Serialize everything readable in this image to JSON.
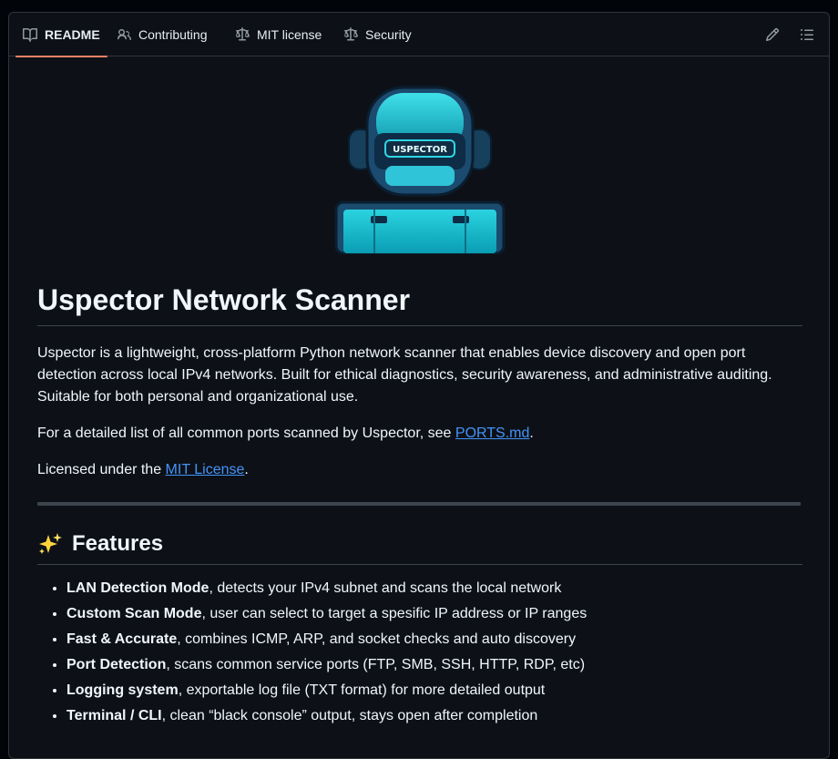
{
  "tabs": [
    {
      "label": "README",
      "icon": "book-icon",
      "active": true
    },
    {
      "label": "Contributing",
      "icon": "people-icon",
      "active": false
    },
    {
      "label": "MIT license",
      "icon": "scale-icon",
      "active": false
    },
    {
      "label": "Security",
      "icon": "scale-icon",
      "active": false
    }
  ],
  "toolbar": {
    "edit_icon": "pencil-icon",
    "outline_icon": "list-icon"
  },
  "logo": {
    "text": "USPECTOR",
    "accent_color": "#1ec8d6"
  },
  "readme": {
    "title": "Uspector Network Scanner",
    "intro": "Uspector is a lightweight, cross-platform Python network scanner that enables device discovery and open port detection across local IPv4 networks. Built for ethical diagnostics, security awareness, and administrative auditing. Suitable for both personal and organizational use.",
    "ports_prefix": "For a detailed list of all common ports scanned by Uspector, see ",
    "ports_link": "PORTS.md",
    "ports_suffix": ".",
    "license_prefix": "Licensed under the ",
    "license_link": "MIT License",
    "license_suffix": ".",
    "features_title": "Features",
    "features_emoji": "sparkles-icon",
    "features": [
      {
        "bold": "LAN Detection Mode",
        "text": ", detects your IPv4 subnet and scans the local network"
      },
      {
        "bold": "Custom Scan Mode",
        "text": ", user can select to target a spesific IP address or IP ranges"
      },
      {
        "bold": "Fast & Accurate",
        "text": ", combines ICMP, ARP, and socket checks and auto discovery"
      },
      {
        "bold": "Port Detection",
        "text": ", scans common service ports (FTP, SMB, SSH, HTTP, RDP, etc)"
      },
      {
        "bold": "Logging system",
        "text": ", exportable log file (TXT format) for more detailed output"
      },
      {
        "bold": "Terminal / CLI",
        "text": ", clean “black console” output, stays open after completion"
      }
    ]
  },
  "colors": {
    "background": "#0d1117",
    "link": "#4493f8",
    "active_tab_underline": "#f78166",
    "border": "#30363d"
  }
}
